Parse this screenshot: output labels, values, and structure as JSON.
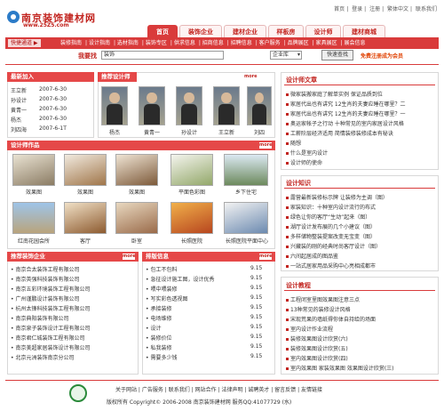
{
  "site": {
    "name": "南京装饰建材网",
    "domain": "www.25Z5.com"
  },
  "top_links": [
    "首页",
    "登录",
    "注册",
    "繁体中文",
    "联系我们"
  ],
  "nav": {
    "tabs": [
      "首页",
      "装饰企业",
      "建材企业",
      "样板房",
      "设计师",
      "建材商城"
    ],
    "active": 0
  },
  "sub_nav": {
    "quick_label": "快捷通道 ▶",
    "items": [
      "装修指南",
      "设计指南",
      "选材指南",
      "装饰专区",
      "供求信息",
      "招商信息",
      "招聘信息",
      "客户服务",
      "品牌展区",
      "家具展区",
      "展会信息"
    ]
  },
  "search": {
    "label": "我要找",
    "value": "装饰",
    "select": "企业库",
    "button": "快速查找",
    "promo": "免费注册成为会员"
  },
  "latest_join": {
    "title": "最新加入",
    "more": "more",
    "items": [
      {
        "name": "王立新",
        "date": "2007-6-30"
      },
      {
        "name": "孙设计",
        "date": "2007-6-30"
      },
      {
        "name": "黄青一",
        "date": "2007-6-30"
      },
      {
        "name": "杨杰",
        "date": "2007-6-30"
      },
      {
        "name": "刘四海",
        "date": "2007-6-1T"
      }
    ]
  },
  "recommended_designers": {
    "title": "推荐设计师",
    "more": "more",
    "names": [
      "杨杰",
      "黄青一",
      "孙设计",
      "王立新",
      "刘四"
    ]
  },
  "design_works": {
    "title": "设计师作品",
    "more": "more",
    "row1": [
      "效果图",
      "效果图",
      "效果图",
      "平面色彩图",
      "乡下住宅"
    ],
    "row2": [
      "红南花园会所",
      "客厅",
      "卧室",
      "长照医院",
      "长照医院平面中心"
    ]
  },
  "recommended_companies": {
    "title": "推荐装饰企业",
    "more": "more",
    "items": [
      "南京合太装饰工程有限公司",
      "南京英强科技装饰有限公司",
      "南京五彩环境装饰工程有限公司",
      "广州谨鹏设计装饰有限公司",
      "杭州太锋科技装饰工程有限公司",
      "南京典阳装饰有限公司",
      "南京泉子装饰设计工程有限公司",
      "南京君仁城装饰工程有限公司",
      "南京美超家居装饰设计有限公司",
      "北京元洲装饰南京分公司"
    ]
  },
  "ranking": {
    "title": "排版信息",
    "more": "more",
    "items": [
      {
        "text": "包工不包料",
        "date": "9.15"
      },
      {
        "text": "急征设计施工图，设计优秀",
        "date": "9.15"
      },
      {
        "text": "喂中喂装修",
        "date": "9.15"
      },
      {
        "text": "写实彩色透视图",
        "date": "9.15"
      },
      {
        "text": "承接装修",
        "date": "9.15"
      },
      {
        "text": "电场维修",
        "date": "9.15"
      },
      {
        "text": "设计",
        "date": "9.15"
      },
      {
        "text": "装修价位",
        "date": "9.15"
      },
      {
        "text": "私我装修",
        "date": "9.15"
      },
      {
        "text": "需要多少钱",
        "date": "9.15"
      }
    ]
  },
  "designer_articles": {
    "title": "设计师文章",
    "items": [
      "微家装搬家庭了解单实例 保证品质到位",
      "家居代出也有讲究 12生肖的夫妻应睡在哪里？二",
      "家居代出也有讲究 12生肖的夫妻应睡在哪里？一",
      "奥运家帐子之行动 十种常见的室内家居设计风格",
      "工薪阶层经济适用 简情装修装修成本有秘诀",
      "随想",
      "什么是室内设计",
      "设计师的使命"
    ]
  },
  "design_knowledge": {
    "title": "设计知识",
    "items": [
      "露营最新装修标示牌 让装修为主调（图）",
      "家装知识：十种室内设计流行的布式",
      "绿色让你的客厅“生动”起来（图）",
      "湖厅设计发布展的几个小建议（图）",
      "多样储物整装提案改变无宝变（图）",
      "兴藏装的刚的经典时尚客厅设计（图）",
      "六间起居成的图品鉴",
      "一站式居家用品采购中心亮相成都市"
    ]
  },
  "design_tutorials": {
    "title": "设计教程",
    "items": [
      "工程闭室里图效果图注意三点",
      "13种常见的装修设计风格",
      "宋现荒果的墙纸得你体自持给的场面",
      "室内设计作业流程",
      "装修效果图设计欣赏(六)",
      "装修效果图设计欣赏(五)",
      "室内效果图设计欣赏(四)",
      "室内效果图 家装效果图 效果图设计欣赏(三)"
    ]
  },
  "footer": {
    "links": [
      "关于网站",
      "广告服务",
      "联系我们",
      "网站合作",
      "法律声明",
      "诚聘英才",
      "留言反馈",
      "友情链接"
    ],
    "copyright": "版权所有 Copyright© 2006-2008 南京装饰建材网 服务QQ:41077729 (水)"
  },
  "colors": {
    "accent": "#d93b3b",
    "brand": "#c2241f"
  }
}
